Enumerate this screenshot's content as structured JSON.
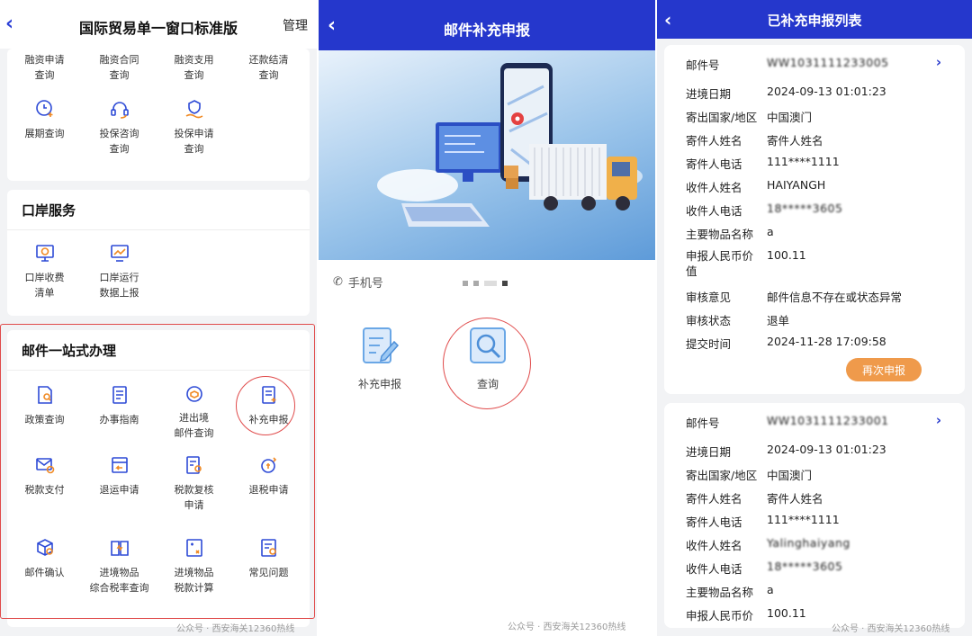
{
  "panel1": {
    "title": "国际贸易单一窗口标准版",
    "manage": "管理",
    "top_row": [
      "融资申请\n查询",
      "融资合同\n查询",
      "融资支用\n查询",
      "还款结清\n查询"
    ],
    "row2": [
      {
        "label": "展期查询",
        "icon": "clock-plus-icon"
      },
      {
        "label": "投保咨询\n查询",
        "icon": "headset-icon"
      },
      {
        "label": "投保申请\n查询",
        "icon": "shield-hand-icon"
      }
    ],
    "port_title": "口岸服务",
    "port_items": [
      {
        "label": "口岸收费\n清单",
        "icon": "monitor-yuan-icon"
      },
      {
        "label": "口岸运行\n数据上报",
        "icon": "chart-monitor-icon"
      }
    ],
    "mail_title": "邮件一站式办理",
    "mail_items": [
      {
        "label": "政策查询",
        "icon": "doc-search-icon"
      },
      {
        "label": "办事指南",
        "icon": "guide-doc-icon"
      },
      {
        "label": "进出境\n邮件查询",
        "icon": "parcel-search-icon"
      },
      {
        "label": "补充申报",
        "icon": "doc-plus-icon"
      },
      {
        "label": "税款支付",
        "icon": "envelope-pay-icon"
      },
      {
        "label": "退运申请",
        "icon": "return-icon"
      },
      {
        "label": "税款复核\n申请",
        "icon": "doc-review-icon"
      },
      {
        "label": "退税申请",
        "icon": "refund-icon"
      },
      {
        "label": "邮件确认",
        "icon": "box-check-icon"
      },
      {
        "label": "进境物品\n综合税率查询",
        "icon": "book-yuan-icon"
      },
      {
        "label": "进境物品\n税款计算",
        "icon": "calc-icon"
      },
      {
        "label": "常见问题",
        "icon": "faq-icon"
      }
    ],
    "watermark": "公众号 · 西安海关12360热线"
  },
  "panel2": {
    "title": "邮件补充申报",
    "phone_label": "手机号",
    "btn_supplement": "补充申报",
    "btn_query": "查询",
    "watermark": "公众号 · 西安海关12360热线"
  },
  "panel3": {
    "title": "已补充申报列表",
    "resubmit": "再次申报",
    "record1": {
      "mail_no_label": "邮件号",
      "mail_no": "WW1031111233005",
      "entry_date_label": "进境日期",
      "entry_date": "2024-09-13 01:01:23",
      "country_label": "寄出国家/地区",
      "country": "中国澳门",
      "sender_name_label": "寄件人姓名",
      "sender_name": "寄件人姓名",
      "sender_phone_label": "寄件人电话",
      "sender_phone": "111****1111",
      "recv_name_label": "收件人姓名",
      "recv_name": "HAIYANGH",
      "recv_phone_label": "收件人电话",
      "recv_phone": "18*****3605",
      "goods_label": "主要物品名称",
      "goods": "a",
      "value_label": "申报人民币价\n值",
      "value": "100.11",
      "opinion_label": "审核意见",
      "opinion": "邮件信息不存在或状态异常",
      "status_label": "审核状态",
      "status": "退单",
      "submit_label": "提交时间",
      "submit": "2024-11-28 17:09:58"
    },
    "record2": {
      "mail_no_label": "邮件号",
      "mail_no": "WW1031111233001",
      "entry_date_label": "进境日期",
      "entry_date": "2024-09-13 01:01:23",
      "country_label": "寄出国家/地区",
      "country": "中国澳门",
      "sender_name_label": "寄件人姓名",
      "sender_name": "寄件人姓名",
      "sender_phone_label": "寄件人电话",
      "sender_phone": "111****1111",
      "recv_name_label": "收件人姓名",
      "recv_name": "Yalinghaiyang",
      "recv_phone_label": "收件人电话",
      "recv_phone": "18*****3605",
      "goods_label": "主要物品名称",
      "goods": "a",
      "value_label": "申报人民币价",
      "value": "100.11"
    },
    "watermark": "公众号 · 西安海关12360热线"
  },
  "colors": {
    "primary": "#2537cc",
    "highlight": "#e04b4b",
    "resubmit": "#ef9a4b"
  }
}
